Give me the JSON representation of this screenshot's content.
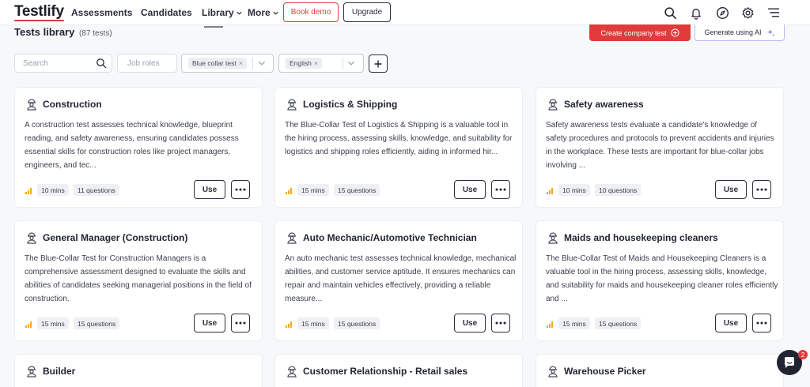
{
  "app": {
    "logo": "Testlify"
  },
  "nav": {
    "assessments": "Assessments",
    "candidates": "Candidates",
    "library": "Library",
    "more": "More",
    "book_demo": "Book demo",
    "upgrade": "Upgrade"
  },
  "library": {
    "title": "Tests library",
    "count": "(87 tests)",
    "create_button": "Create company test",
    "generate_button": "Generate using AI"
  },
  "filters": {
    "search_placeholder": "Search",
    "job_roles_placeholder": "Job roles",
    "category_chip": "Blue collar test",
    "language_chip": "English"
  },
  "colors": {
    "accent": "#e03b3b",
    "dark": "#1f2430",
    "ai_border": "#b9bdf0",
    "bars": "#f5a623"
  },
  "cards": [
    {
      "title": "Construction",
      "desc": "A construction test assesses technical knowledge, blueprint reading, and safety awareness, ensuring candidates possess essential skills for construction roles like project managers, engineers, and tec...",
      "duration": "10 mins",
      "questions": "11 questions",
      "use": "Use"
    },
    {
      "title": "Logistics & Shipping",
      "desc": "The Blue-Collar Test of Logistics & Shipping is a valuable tool in the hiring process, assessing skills, knowledge, and suitability for logistics and shipping roles efficiently, aiding in informed hir...",
      "duration": "15 mins",
      "questions": "15 questions",
      "use": "Use"
    },
    {
      "title": "Safety awareness",
      "desc": "Safety awareness tests evaluate a candidate's knowledge of safety procedures and protocols to prevent accidents and injuries in the workplace. These tests are important for blue-collar jobs involving ...",
      "duration": "10 mins",
      "questions": "10 questions",
      "use": "Use"
    },
    {
      "title": "General Manager (Construction)",
      "desc": "The Blue-Collar Test for Construction Managers is a comprehensive assessment designed to evaluate the skills and abilities of candidates seeking managerial positions in the field of construction.",
      "duration": "15 mins",
      "questions": "15 questions",
      "use": "Use"
    },
    {
      "title": "Auto Mechanic/Automotive Technician",
      "desc": "An auto mechanic test assesses technical knowledge, mechanical abilities, and customer service aptitude. It ensures mechanics can repair and maintain vehicles effectively, providing a reliable measure...",
      "duration": "15 mins",
      "questions": "15 questions",
      "use": "Use"
    },
    {
      "title": "Maids and housekeeping cleaners",
      "desc": "The Blue-Collar Test of Maids and Housekeeping Cleaners is a valuable tool in the hiring process, assessing skills, knowledge, and suitability for maids and housekeeping cleaner roles efficiently and ...",
      "duration": "15 mins",
      "questions": "15 questions",
      "use": "Use"
    },
    {
      "title": "Builder"
    },
    {
      "title": "Customer Relationship - Retail sales"
    },
    {
      "title": "Warehouse Picker"
    }
  ],
  "chat": {
    "badge": "2"
  }
}
